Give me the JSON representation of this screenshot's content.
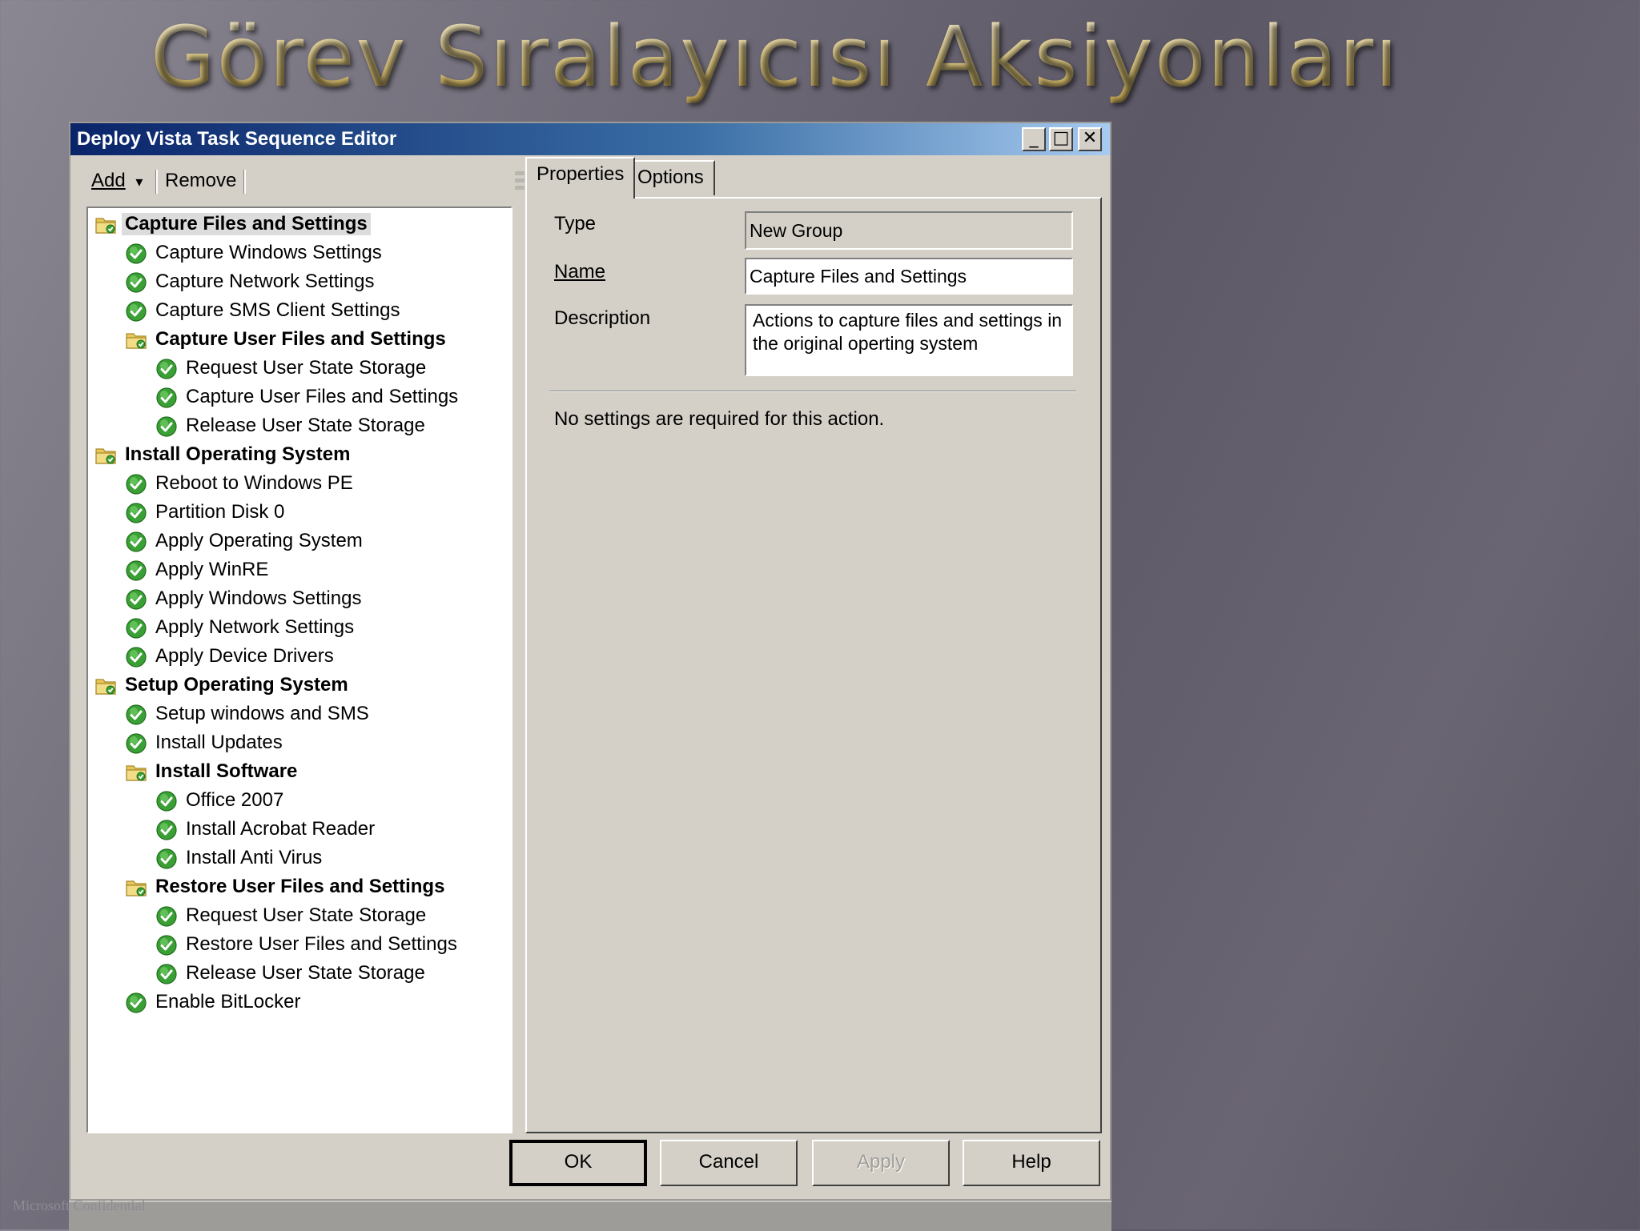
{
  "slide": {
    "title": "Görev Sıralayıcısı Aksiyonları"
  },
  "window": {
    "title": "Deploy Vista Task Sequence Editor",
    "controls": {
      "minimize": "_",
      "maximize": "□",
      "close": "✕"
    }
  },
  "toolbar": {
    "add_label": "Add",
    "add_arrow": "▾",
    "remove_label": "Remove"
  },
  "tree": [
    {
      "label": "Capture Files and Settings",
      "type": "group",
      "level": 0,
      "selected": true
    },
    {
      "label": "Capture Windows Settings",
      "type": "step",
      "level": 1
    },
    {
      "label": "Capture Network Settings",
      "type": "step",
      "level": 1
    },
    {
      "label": "Capture SMS Client Settings",
      "type": "step",
      "level": 1
    },
    {
      "label": "Capture User Files and Settings",
      "type": "group",
      "level": 1
    },
    {
      "label": "Request User State Storage",
      "type": "step",
      "level": 2
    },
    {
      "label": "Capture User Files and Settings",
      "type": "step",
      "level": 2
    },
    {
      "label": "Release User State Storage",
      "type": "step",
      "level": 2
    },
    {
      "label": "Install Operating System",
      "type": "group",
      "level": 0
    },
    {
      "label": "Reboot to Windows PE",
      "type": "step",
      "level": 1
    },
    {
      "label": "Partition Disk 0",
      "type": "step",
      "level": 1
    },
    {
      "label": "Apply Operating System",
      "type": "step",
      "level": 1
    },
    {
      "label": "Apply WinRE",
      "type": "step",
      "level": 1
    },
    {
      "label": "Apply Windows Settings",
      "type": "step",
      "level": 1
    },
    {
      "label": "Apply Network Settings",
      "type": "step",
      "level": 1
    },
    {
      "label": "Apply Device Drivers",
      "type": "step",
      "level": 1
    },
    {
      "label": "Setup Operating System",
      "type": "group",
      "level": 0
    },
    {
      "label": "Setup windows and SMS",
      "type": "step",
      "level": 1
    },
    {
      "label": "Install Updates",
      "type": "step",
      "level": 1
    },
    {
      "label": "Install Software",
      "type": "group",
      "level": 1
    },
    {
      "label": "Office 2007",
      "type": "step",
      "level": 2
    },
    {
      "label": "Install Acrobat Reader",
      "type": "step",
      "level": 2
    },
    {
      "label": "Install Anti Virus",
      "type": "step",
      "level": 2
    },
    {
      "label": "Restore User Files and Settings",
      "type": "group",
      "level": 1
    },
    {
      "label": "Request User State Storage",
      "type": "step",
      "level": 2
    },
    {
      "label": "Restore User Files and Settings",
      "type": "step",
      "level": 2
    },
    {
      "label": "Release User State Storage",
      "type": "step",
      "level": 2
    },
    {
      "label": "Enable BitLocker",
      "type": "step",
      "level": 1
    }
  ],
  "tabs": [
    {
      "label": "Properties",
      "active": true
    },
    {
      "label": "Options",
      "active": false
    }
  ],
  "properties": {
    "type_label": "Type",
    "type_value": "New Group",
    "name_label": "Name",
    "name_value": "Capture Files and Settings",
    "description_label": "Description",
    "description_value": "Actions to capture files and settings in the original operting system",
    "note": "No settings are required  for this action."
  },
  "buttons": {
    "ok": "OK",
    "cancel": "Cancel",
    "apply": "Apply",
    "help": "Help"
  },
  "footer": {
    "confidential": "Microsoft Confidential"
  },
  "icons": {
    "group": "folder-icon",
    "step": "check-icon"
  },
  "colors": {
    "titlebar_start": "#0a246a",
    "titlebar_end": "#a6caf0",
    "check_green": "#3aa035",
    "folder_yellow": "#e8c65a"
  }
}
